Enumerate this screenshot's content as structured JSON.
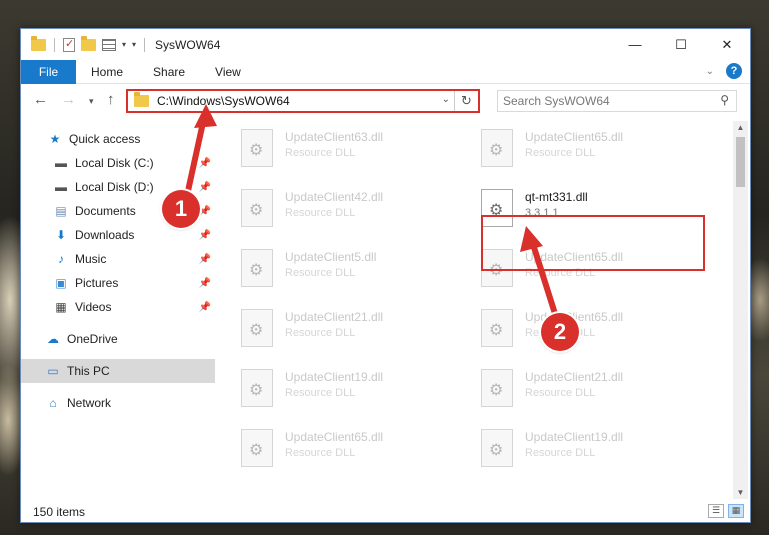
{
  "window": {
    "title": "SysWOW64",
    "controls": [
      "—",
      "☐",
      "✕"
    ]
  },
  "ribbon": {
    "tabs": [
      "File",
      "Home",
      "Share",
      "View"
    ],
    "help": "?"
  },
  "address": {
    "path": "C:\\Windows\\SysWOW64",
    "search_placeholder": "Search SysWOW64"
  },
  "nav": {
    "items": [
      {
        "label": "Quick access",
        "icon": "star-icon",
        "pinned": false
      },
      {
        "label": "Local Disk (C:)",
        "icon": "drive-icon",
        "pinned": true
      },
      {
        "label": "Local Disk (D:)",
        "icon": "drive-icon",
        "pinned": true
      },
      {
        "label": "Documents",
        "icon": "documents-icon",
        "pinned": true
      },
      {
        "label": "Downloads",
        "icon": "download-icon",
        "pinned": true
      },
      {
        "label": "Music",
        "icon": "music-icon",
        "pinned": true
      },
      {
        "label": "Pictures",
        "icon": "pictures-icon",
        "pinned": true
      },
      {
        "label": "Videos",
        "icon": "video-icon",
        "pinned": true
      },
      {
        "label": "OneDrive",
        "icon": "cloud-icon",
        "pinned": false
      },
      {
        "label": "This PC",
        "icon": "computer-icon",
        "pinned": false
      },
      {
        "label": "Network",
        "icon": "network-icon",
        "pinned": false
      }
    ]
  },
  "files": [
    {
      "name": "UpdateClient63.dll",
      "desc": "Resource DLL"
    },
    {
      "name": "UpdateClient65.dll",
      "desc": "Resource DLL"
    },
    {
      "name": "UpdateClient42.dll",
      "desc": "Resource DLL"
    },
    {
      "name": "qt-mt331.dll",
      "desc": "3.3.1.1"
    },
    {
      "name": "UpdateClient5.dll",
      "desc": "Resource DLL"
    },
    {
      "name": "UpdateClient65.dll",
      "desc": "Resource DLL"
    },
    {
      "name": "UpdateClient21.dll",
      "desc": "Resource DLL"
    },
    {
      "name": "UpdateClient65.dll",
      "desc": "Resource DLL"
    },
    {
      "name": "UpdateClient19.dll",
      "desc": "Resource DLL"
    },
    {
      "name": "UpdateClient21.dll",
      "desc": "Resource DLL"
    },
    {
      "name": "UpdateClient65.dll",
      "desc": "Resource DLL"
    },
    {
      "name": "UpdateClient19.dll",
      "desc": "Resource DLL"
    }
  ],
  "status": {
    "item_count": "150 items"
  },
  "callouts": [
    "1",
    "2"
  ],
  "colors": {
    "accent": "#1979ca",
    "highlight": "#d9302c"
  }
}
